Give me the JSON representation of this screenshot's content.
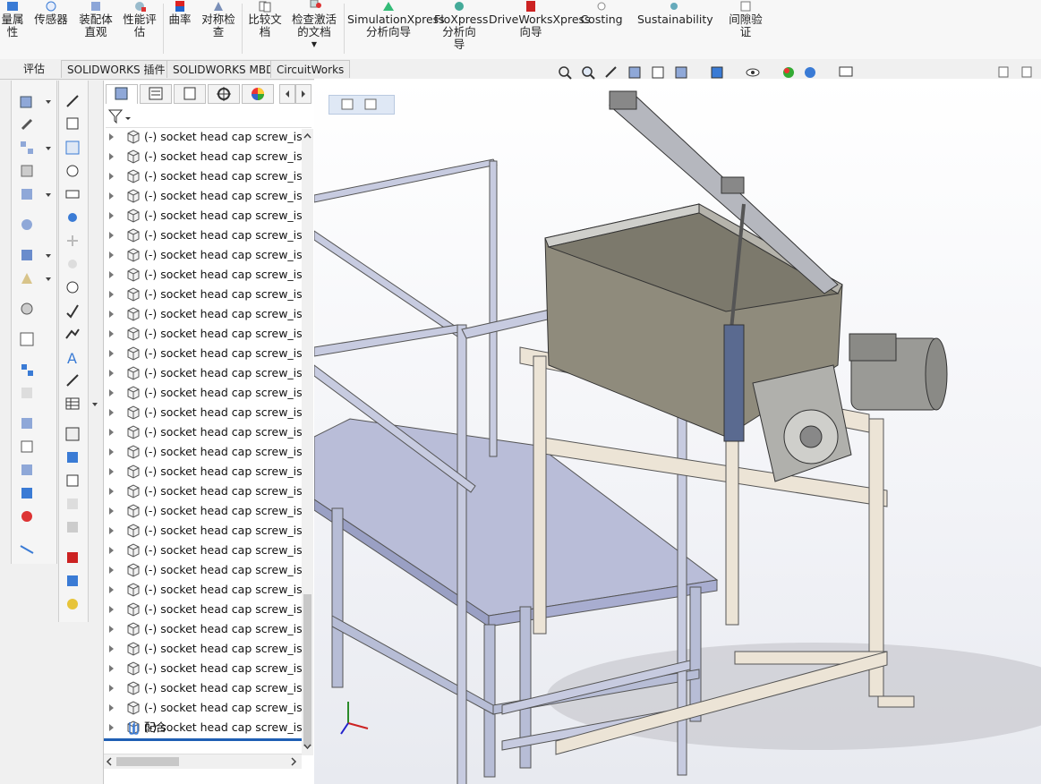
{
  "ribbon": {
    "buttons": [
      {
        "id": "mass-props",
        "lines": [
          "量属",
          "性"
        ]
      },
      {
        "id": "sensors",
        "lines": [
          "传感器"
        ]
      },
      {
        "id": "assembly-visual",
        "lines": [
          "装配体",
          "直观"
        ]
      },
      {
        "id": "performance",
        "lines": [
          "性能评",
          "估"
        ]
      },
      {
        "id": "curvature",
        "lines": [
          "曲率"
        ]
      },
      {
        "id": "symmetry",
        "lines": [
          "对称检",
          "查"
        ]
      },
      {
        "id": "compare-docs",
        "lines": [
          "比较文",
          "档"
        ]
      },
      {
        "id": "check-active",
        "lines": [
          "检查激活",
          "的文档"
        ]
      },
      {
        "id": "simulationxpress",
        "lines": [
          "SimulationXpress",
          "分析向导"
        ]
      },
      {
        "id": "floxpress",
        "lines": [
          "FloXpress",
          "分析向",
          "导"
        ]
      },
      {
        "id": "driveworksxpress",
        "lines": [
          "DriveWorksXpress",
          "向导"
        ]
      },
      {
        "id": "costing",
        "lines": [
          "Costing"
        ]
      },
      {
        "id": "sustainability",
        "lines": [
          "Sustainability"
        ]
      },
      {
        "id": "clearance",
        "lines": [
          "间隙验",
          "证"
        ]
      }
    ]
  },
  "tabs": [
    "评估",
    "SOLIDWORKS 插件",
    "SOLIDWORKS MBD",
    "CircuitWorks"
  ],
  "tree": {
    "prefix": "(-)",
    "item_label": "(-) socket head cap screw_iso",
    "items": [
      "(-) socket head cap screw_iso",
      "(-) socket head cap screw_iso",
      "(-) socket head cap screw_iso",
      "(-) socket head cap screw_iso",
      "(-) socket head cap screw_iso",
      "(-) socket head cap screw_iso",
      "(-) socket head cap screw_iso",
      "(-) socket head cap screw_iso",
      "(-) socket head cap screw_iso",
      "(-) socket head cap screw_iso",
      "(-) socket head cap screw_iso",
      "(-) socket head cap screw_iso",
      "(-) socket head cap screw_iso",
      "(-) socket head cap screw_iso",
      "(-) socket head cap screw_iso",
      "(-) socket head cap screw_iso",
      "(-) socket head cap screw_iso",
      "(-) socket head cap screw_iso",
      "(-) socket head cap screw_iso",
      "(-) socket head cap screw_iso",
      "(-) socket head cap screw_iso",
      "(-) socket head cap screw_iso",
      "(-) socket head cap screw_iso",
      "(-) socket head cap screw_iso",
      "(-) socket head cap screw_iso",
      "(-) socket head cap screw_iso",
      "(-) socket head cap screw_iso",
      "(-) socket head cap screw_iso",
      "(-) socket head cap screw_iso",
      "(-) socket head cap screw_iso",
      "(-) socket head cap screw_iso"
    ],
    "mates_label": "配合"
  },
  "colors": {
    "accent": "#1f5fb4",
    "frame": "#b7bdd6",
    "beige": "#ece4d6",
    "steel": "#9a9a96"
  }
}
